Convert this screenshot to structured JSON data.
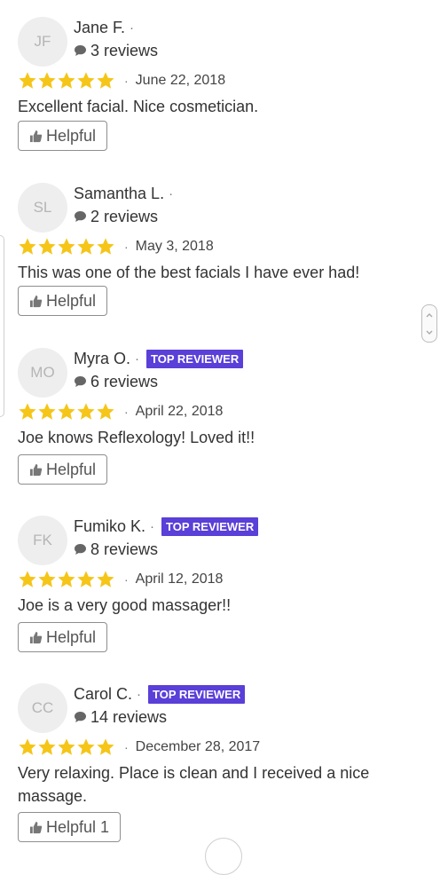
{
  "colors": {
    "star": "#f5c518",
    "badge": "#5a3fd8",
    "avatar_bg": "#eeeeee"
  },
  "icons": {
    "stars": "star-icon",
    "review_count": "speech-bubble-icon",
    "helpful": "thumbs-up-icon"
  },
  "reviews": [
    {
      "initials": "JF",
      "name": "Jane F.",
      "separator": "·",
      "top_reviewer": false,
      "badge": "",
      "review_count": "3 reviews",
      "rating": 5,
      "date_separator": "·",
      "date": "June 22, 2018",
      "text": "Excellent facial. Nice cosmetician.",
      "helpful_label": "Helpful"
    },
    {
      "initials": "SL",
      "name": "Samantha L.",
      "separator": "·",
      "top_reviewer": false,
      "badge": "",
      "review_count": "2 reviews",
      "rating": 5,
      "date_separator": "·",
      "date": "May 3, 2018",
      "text": "This was one of the best facials I have ever had!",
      "helpful_label": "Helpful"
    },
    {
      "initials": "MO",
      "name": "Myra O.",
      "separator": "·",
      "top_reviewer": true,
      "badge": "TOP REVIEWER",
      "review_count": "6 reviews",
      "rating": 5,
      "date_separator": "·",
      "date": "April 22, 2018",
      "text": "Joe knows Reflexology! Loved it!!",
      "helpful_label": "Helpful"
    },
    {
      "initials": "FK",
      "name": "Fumiko K.",
      "separator": "·",
      "top_reviewer": true,
      "badge": "TOP REVIEWER",
      "review_count": "8 reviews",
      "rating": 5,
      "date_separator": "·",
      "date": "April 12, 2018",
      "text": "Joe is a very good massager!!",
      "helpful_label": "Helpful"
    },
    {
      "initials": "CC",
      "name": "Carol C.",
      "separator": "·",
      "top_reviewer": true,
      "badge": "TOP REVIEWER",
      "review_count": "14 reviews",
      "rating": 5,
      "date_separator": "·",
      "date": "December 28, 2017",
      "text": "Very relaxing. Place is clean and I received a nice massage.",
      "helpful_label": "Helpful 1"
    }
  ]
}
